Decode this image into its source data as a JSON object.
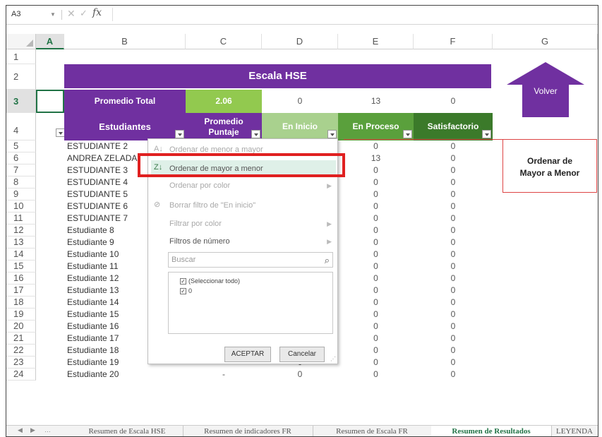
{
  "formula_bar": {
    "name_box": "A3",
    "fx": "fx"
  },
  "columns": [
    "A",
    "B",
    "C",
    "D",
    "E",
    "F",
    "G"
  ],
  "rows": [
    "1",
    "2",
    "3",
    "4",
    "5",
    "6",
    "7",
    "8",
    "9",
    "10",
    "11",
    "12",
    "13",
    "14",
    "15",
    "16",
    "17",
    "18",
    "19",
    "20",
    "21",
    "22",
    "23",
    "24"
  ],
  "sheet": {
    "title": "Escala HSE",
    "promedio_total_label": "Promedio Total",
    "promedio_total_value": "2.06",
    "summary_values": [
      "0",
      "13",
      "0"
    ],
    "headers": {
      "estudiantes": "Estudiantes",
      "promedio_line1": "Promedio",
      "promedio_line2": "Puntaje",
      "en_inicio": "En Inicio",
      "en_proceso": "En Proceso",
      "satisfactorio": "Satisfactorio"
    },
    "students": [
      "ESTUDIANTE 2",
      "ANDREA ZELADA",
      "ESTUDIANTE 3",
      "ESTUDIANTE 4",
      "ESTUDIANTE 5",
      "ESTUDIANTE 6",
      "ESTUDIANTE 7",
      "Estudiante 8",
      "Estudiante 9",
      "Estudiante 10",
      "Estudiante 11",
      "Estudiante 12",
      "Estudiante 13",
      "Estudiante 14",
      "Estudiante 15",
      "Estudiante 16",
      "Estudiante 17",
      "Estudiante 18",
      "Estudiante 19",
      "Estudiante 20"
    ],
    "col_e": [
      "0",
      "13",
      "0",
      "0",
      "0",
      "0",
      "0",
      "0",
      "0",
      "0",
      "0",
      "0",
      "0",
      "0",
      "0",
      "0",
      "0",
      "0",
      "0",
      "0"
    ],
    "col_f": [
      "0",
      "0",
      "0",
      "0",
      "0",
      "0",
      "0",
      "0",
      "0",
      "0",
      "0",
      "0",
      "0",
      "0",
      "0",
      "0",
      "0",
      "0",
      "0",
      "0"
    ],
    "tail_c": [
      "-",
      "-",
      "-",
      "-"
    ],
    "tail_d": [
      "0",
      "0",
      "0",
      "0"
    ]
  },
  "volver_label": "Volver",
  "callout": {
    "line1": "Ordenar de",
    "line2": "Mayor a Menor"
  },
  "menu": {
    "sort_asc": "Ordenar de menor a mayor",
    "sort_desc": "Ordenar de mayor a menor",
    "sort_color": "Ordenar por color",
    "clear_filter": "Borrar filtro de \"En inicio\"",
    "filter_color": "Filtrar por color",
    "number_filters": "Filtros de número",
    "search_placeholder": "Buscar",
    "select_all": "(Seleccionar todo)",
    "item_zero": "0",
    "accept": "ACEPTAR",
    "cancel": "Cancelar"
  },
  "tabs": [
    "Resumen de Escala HSE",
    "Resumen de indicadores FR",
    "Resumen de Escala FR",
    "Resumen de Resultados",
    "LEYENDA"
  ],
  "colors": {
    "purple": "#7030a0",
    "green_accent": "#217346",
    "highlight_red": "#e02020"
  }
}
